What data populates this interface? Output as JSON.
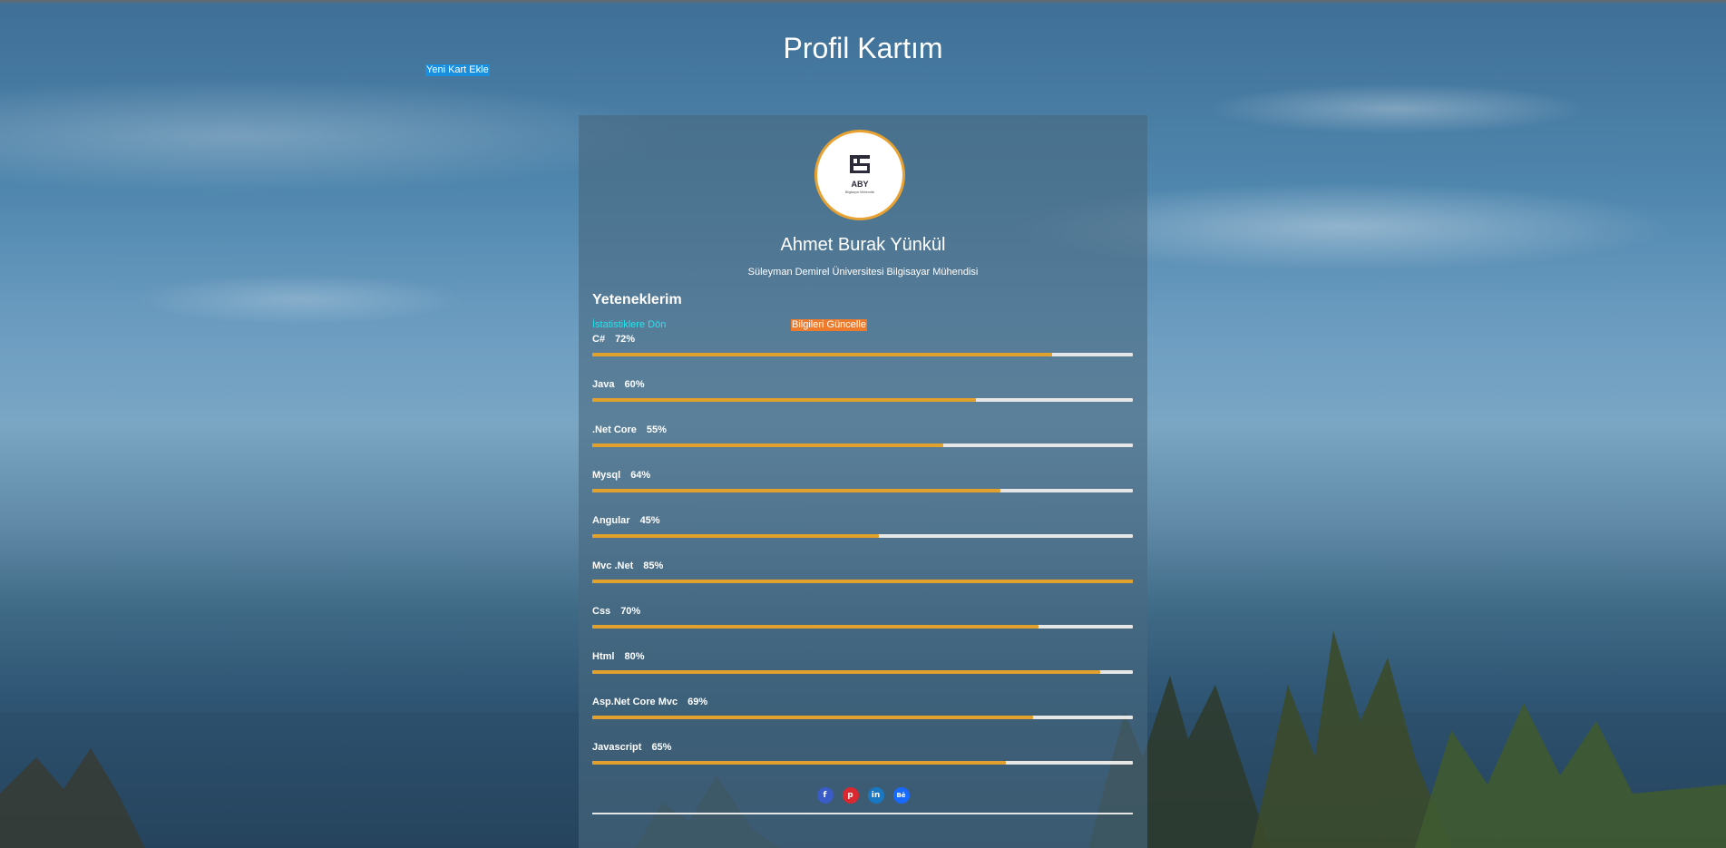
{
  "header": {
    "title": "Profil Kartım",
    "new_card_label": "Yeni Kart Ekle"
  },
  "profile": {
    "logo_text": "ABY",
    "logo_subtext": "Bilgisayar Mühendisi",
    "name": "Ahmet Burak Yünkül",
    "subtitle": "Süleyman Demirel Üniversitesi Bilgisayar Mühendisi"
  },
  "skills_section": {
    "heading": "Yeteneklerim",
    "stats_link": "İstatistiklere Dön",
    "update_button": "Bilgileri Güncelle"
  },
  "skills": [
    {
      "name": "C#",
      "percent_label": "72%",
      "fill": 0.85
    },
    {
      "name": "Java",
      "percent_label": "60%",
      "fill": 0.71
    },
    {
      "name": ".Net Core",
      "percent_label": "55%",
      "fill": 0.65
    },
    {
      "name": "Mysql",
      "percent_label": "64%",
      "fill": 0.755
    },
    {
      "name": "Angular",
      "percent_label": "45%",
      "fill": 0.53
    },
    {
      "name": "Mvc .Net",
      "percent_label": "85%",
      "fill": 1.0
    },
    {
      "name": "Css",
      "percent_label": "70%",
      "fill": 0.825
    },
    {
      "name": "Html",
      "percent_label": "80%",
      "fill": 0.94
    },
    {
      "name": "Asp.Net Core Mvc",
      "percent_label": "69%",
      "fill": 0.815
    },
    {
      "name": "Javascript",
      "percent_label": "65%",
      "fill": 0.765
    }
  ],
  "socials": [
    {
      "icon": "facebook-icon",
      "glyph": "f"
    },
    {
      "icon": "pinterest-icon",
      "glyph": "p"
    },
    {
      "icon": "linkedin-icon",
      "glyph": "in"
    },
    {
      "icon": "behance-icon",
      "glyph": "Bē"
    }
  ],
  "colors": {
    "bar_fill": "#e2a02d",
    "bar_track": "#e6e6e6",
    "avatar_border": "#e8a232",
    "update_button": "#ee7a2c",
    "new_card_button": "#1a8fe0",
    "stats_link": "#29e3ee"
  }
}
